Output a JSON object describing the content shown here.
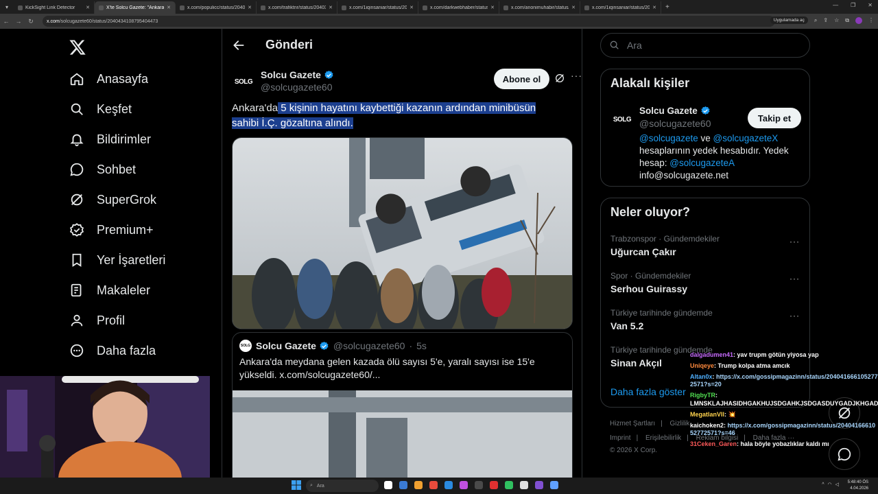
{
  "browser": {
    "tabs": [
      {
        "label": "KickSight Link Detector",
        "active": false
      },
      {
        "label": "X'te Solcu Gazete: \"Ankara'da 5",
        "active": true
      },
      {
        "label": "x.com/populicc/status/2040078",
        "active": false
      },
      {
        "label": "x.com/trafiktnr/status/2040324",
        "active": false
      },
      {
        "label": "x.com/1iqinsaniar/status/20403",
        "active": false
      },
      {
        "label": "x.com/darkwebhaber/status/20",
        "active": false
      },
      {
        "label": "x.com/anonimuhabir/status/20",
        "active": false
      },
      {
        "label": "x.com/1iqinsaniar/status/2040",
        "active": false
      }
    ],
    "url_host": "x.com",
    "url_path": "/solcugazete60/status/2040434108795404473",
    "apps_chip": "Uygulamada aç"
  },
  "nav": {
    "items": [
      {
        "label": "Anasayfa",
        "icon": "home-icon"
      },
      {
        "label": "Keşfet",
        "icon": "search-icon"
      },
      {
        "label": "Bildirimler",
        "icon": "bell-icon"
      },
      {
        "label": "Sohbet",
        "icon": "chat-icon"
      },
      {
        "label": "SuperGrok",
        "icon": "grok-icon"
      },
      {
        "label": "Premium+",
        "icon": "premium-icon"
      },
      {
        "label": "Yer İşaretleri",
        "icon": "bookmark-icon"
      },
      {
        "label": "Makaleler",
        "icon": "article-icon"
      },
      {
        "label": "Profil",
        "icon": "profile-icon"
      },
      {
        "label": "Daha fazla",
        "icon": "more-icon"
      }
    ]
  },
  "post": {
    "header_title": "Gönderi",
    "author_name": "Solcu Gazete",
    "author_handle": "@solcugazete60",
    "avatar_text": "SOLG",
    "follow_label": "Abone ol",
    "text_plain": "Ankara'da",
    "text_highlight": " 5 kişinin hayatını kaybettiği kazanın ardından minibüsün sahibi İ.Ç. gözaltına alındı.",
    "quote": {
      "author_name": "Solcu Gazete",
      "author_handle": "@solcugazete60",
      "time": "5s",
      "text": "Ankara'da meydana gelen kazada ölü sayısı 5'e, yaralı sayısı ise 15'e yükseldi. x.com/solcugazete60/..."
    }
  },
  "right": {
    "search_placeholder": "Ara",
    "related": {
      "title": "Alakalı kişiler",
      "name": "Solcu Gazete",
      "handle": "@solcugazete60",
      "avatar_text": "SOLG",
      "button": "Takip et",
      "bio_link1": "@solcugazete",
      "bio_and": " ve ",
      "bio_link2": "@solcugazeteX",
      "bio_mid": " hesaplarının yedek hesabıdır. Yedek hesap: ",
      "bio_link3": "@solcugazeteA",
      "bio_email": " info@solcugazete.net"
    },
    "trends": {
      "title": "Neler oluyor?",
      "items": [
        {
          "category": "Trabzonspor · Gündemdekiler",
          "title": "Uğurcan Çakır"
        },
        {
          "category": "Spor · Gündemdekiler",
          "title": "Serhou Guirassy"
        },
        {
          "category": "Türkiye tarihinde gündemde",
          "title": "Van 5.2"
        },
        {
          "category": "Türkiye tarihinde gündemde",
          "title": "Sinan Akçıl"
        }
      ],
      "show_more": "Daha fazla göster"
    },
    "footer": {
      "row1": [
        "Hizmet Şartları",
        "Gizlilik"
      ],
      "row2": [
        "Imprint",
        "Erişilebilirlik",
        "Reklam bilgisi",
        "Daha fazla ···"
      ],
      "copyright": "© 2026 X Corp."
    }
  },
  "chat": [
    {
      "user": "dalgadumen41",
      "msg": "yav trupm götün yiyosa yap",
      "color": "#c86cff"
    },
    {
      "user": "Uniqeye",
      "msg": "Trump kolpa atma amcık",
      "color": "#ff8a3d"
    },
    {
      "user": "Altan0x",
      "msg": "https://x.com/gossipmagazinn/status/2040416661052772571?s=20",
      "color": "#4fb0ff"
    },
    {
      "user": "RigbyTR",
      "msg": "LMNSKLAJHASIDHGAKHUJSDGAHKJSDGASDUYGADJKHGADJHKG",
      "color": "#52e052"
    },
    {
      "user": "MegatlanVII",
      "msg": "💥",
      "color": "#ffd34d"
    },
    {
      "user": "kaichoken2",
      "msg": "https://x.com/gossipmagazinn/status/2040416661052772571?s=46",
      "color": "#ffffff"
    },
    {
      "user": "31Ceken_Garen",
      "msg": "hala böyle yobazlıklar kaldı mı",
      "color": "#ff5a5a"
    }
  ],
  "taskbar": {
    "search": "Ara",
    "time": "5:48:40 ÖS",
    "date": "4.04.2026"
  },
  "colors": {
    "accent": "#1d9bf0",
    "highlight": "#1c3f8f",
    "border": "#2f3336"
  }
}
